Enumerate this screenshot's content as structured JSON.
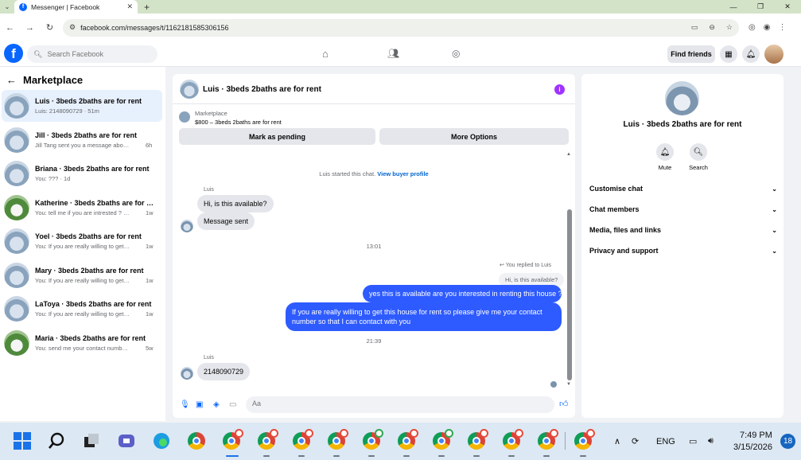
{
  "browser": {
    "tab_title": "Messenger | Facebook",
    "url": "facebook.com/messages/t/1162181585306156"
  },
  "header": {
    "search_placeholder": "Search Facebook",
    "find_friends": "Find friends"
  },
  "sidebar": {
    "title": "Marketplace",
    "conversations": [
      {
        "name": "Luis · 3beds 2baths are for rent",
        "preview": "Luis: 2148090729 · 51m",
        "time": ""
      },
      {
        "name": "Jill · 3beds 2baths are for rent",
        "preview": "Jill Tang sent you a message about yo...",
        "time": "6h"
      },
      {
        "name": "Briana · 3beds 2baths are for rent",
        "preview": "You: ??? · 1d",
        "time": ""
      },
      {
        "name": "Katherine · 3beds 2baths are for re...",
        "preview": "You: tell me if you are intrested ? this ...",
        "time": "1w"
      },
      {
        "name": "Yoel · 3beds 2baths are for rent",
        "preview": "You: If you are really willing to get thi...",
        "time": "1w"
      },
      {
        "name": "Mary · 3beds 2baths are for rent",
        "preview": "You: If you are really willing to get thi...",
        "time": "1w"
      },
      {
        "name": "LaToya · 3beds 2baths are for rent",
        "preview": "You: If you are really willing to get thi...",
        "time": "1w"
      },
      {
        "name": "Maria · 3beds 2baths are for rent",
        "preview": "You: send me your contact number i ...",
        "time": "5w"
      }
    ]
  },
  "chat": {
    "title": "Luis · 3beds 2baths are for rent",
    "marketplace_label": "Marketplace",
    "listing": "$800 – 3beds 2baths are for rent",
    "mark_pending": "Mark as pending",
    "more_options": "More Options",
    "started": "Luis started this chat.",
    "view_profile": "View buyer profile",
    "sender_1": "Luis",
    "msg_1": "Hi, is this available?",
    "msg_2": "Message sent",
    "time_1": "13:01",
    "replied_to": "You replied to Luis",
    "quoted": "Hi, is this available?",
    "msg_3": "yes this is available are you interested in renting this house ?",
    "msg_4": "If you are really willing to get this house for rent so please give me your contact number so that I  can contact with you",
    "time_2": "21:39",
    "sender_2": "Luis",
    "msg_5": "2148090729",
    "composer_placeholder": "Aa"
  },
  "details": {
    "name": "Luis · 3beds 2baths are for rent",
    "mute": "Mute",
    "search": "Search",
    "sections": [
      "Customise chat",
      "Chat members",
      "Media, files and links",
      "Privacy and support"
    ]
  },
  "taskbar": {
    "lang": "ENG",
    "time": "7:49 PM",
    "date": "3/15/2026",
    "notifications": "18"
  }
}
